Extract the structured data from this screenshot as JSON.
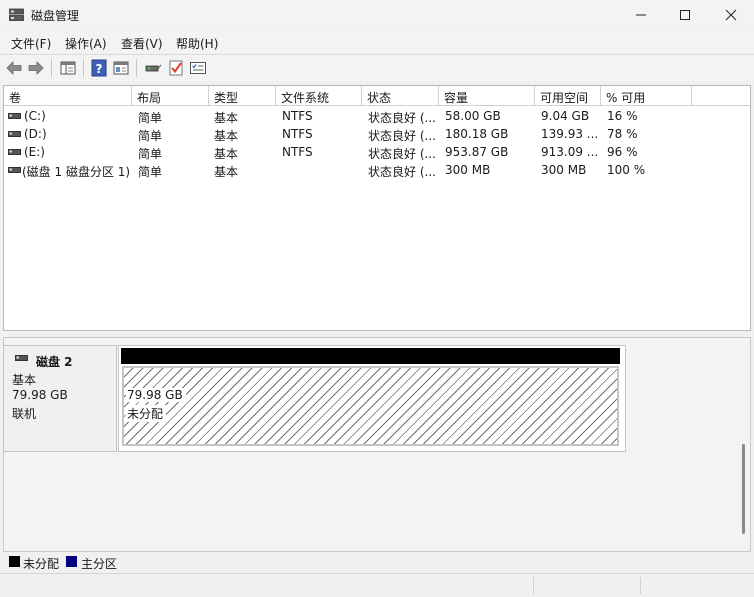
{
  "window": {
    "title": "磁盘管理",
    "icon": "disk-management-icon"
  },
  "menu": {
    "items": [
      "文件(F)",
      "操作(A)",
      "查看(V)",
      "帮助(H)"
    ]
  },
  "toolbar": {
    "icons": [
      "back-arrow-icon",
      "forward-arrow-icon",
      "show-hide-console-tree-icon",
      "help-icon",
      "properties-icon",
      "connect-disk-icon",
      "checkmark-icon",
      "settings-list-icon"
    ]
  },
  "volume_list": {
    "columns": [
      "卷",
      "布局",
      "类型",
      "文件系统",
      "状态",
      "容量",
      "可用空间",
      "% 可用"
    ],
    "rows": [
      {
        "volume": "(C:)",
        "layout": "简单",
        "type": "基本",
        "fs": "NTFS",
        "status": "状态良好 (...",
        "capacity": "58.00 GB",
        "free": "9.04 GB",
        "pct": "16 %"
      },
      {
        "volume": "(D:)",
        "layout": "简单",
        "type": "基本",
        "fs": "NTFS",
        "status": "状态良好 (...",
        "capacity": "180.18 GB",
        "free": "139.93 ...",
        "pct": "78 %"
      },
      {
        "volume": "(E:)",
        "layout": "简单",
        "type": "基本",
        "fs": "NTFS",
        "status": "状态良好 (...",
        "capacity": "953.87 GB",
        "free": "913.09 ...",
        "pct": "96 %"
      },
      {
        "volume": "(磁盘 1 磁盘分区 1)",
        "layout": "简单",
        "type": "基本",
        "fs": "",
        "status": "状态良好 (...",
        "capacity": "300 MB",
        "free": "300 MB",
        "pct": "100 %"
      }
    ]
  },
  "disk": {
    "name": "磁盘 2",
    "type": "基本",
    "size": "79.98 GB",
    "state": "联机",
    "partition": {
      "size": "79.98 GB",
      "label": "未分配"
    }
  },
  "legend": {
    "items": [
      {
        "label": "未分配",
        "color": "#000000"
      },
      {
        "label": "主分区",
        "color": "#000080"
      }
    ]
  },
  "colors": {
    "unallocated": "#000000",
    "primary": "#000080"
  }
}
